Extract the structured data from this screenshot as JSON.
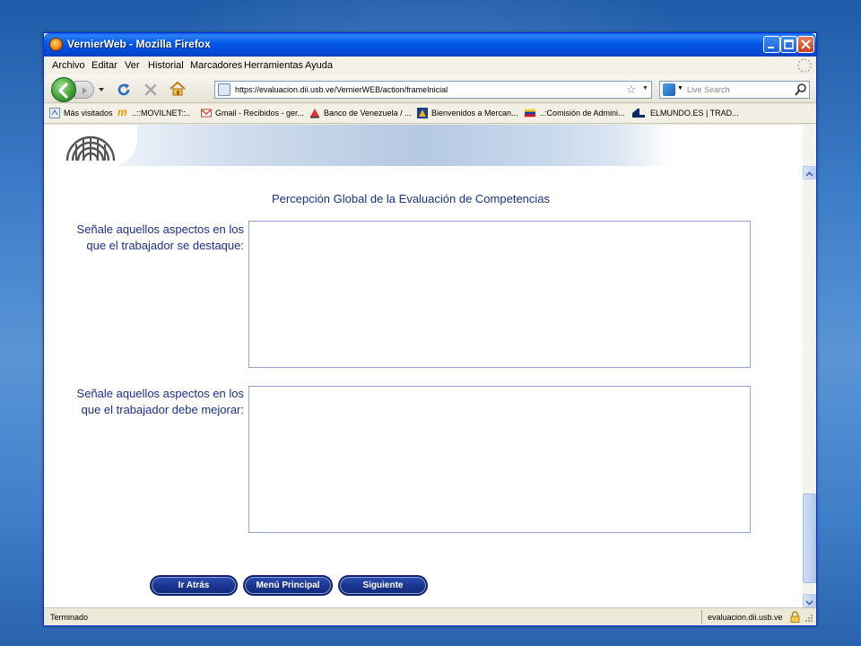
{
  "window": {
    "title": "VernierWeb - Mozilla Firefox"
  },
  "menu": {
    "items": [
      "Archivo",
      "Editar",
      "Ver",
      "Historial",
      "Marcadores",
      "Herramientas",
      "Ayuda"
    ]
  },
  "navigation": {
    "url": "https://evaluacion.dii.usb.ve/VernierWEB/action/frameInicial",
    "search_placeholder": "Live Search"
  },
  "bookmarks": [
    "Más visitados",
    "..::MOVILNET::..",
    "Gmail - Recibidos - ger...",
    "Banco de Venezuela / ...",
    "Bienvenidos a Mercan...",
    "..:Comisión de Admini...",
    "ELMUNDO.ES | TRAD..."
  ],
  "page": {
    "heading": "Percepción Global de la Evaluación de Competencias",
    "field1_line1": "Señale aquellos aspectos en los",
    "field1_line2": "que el trabajador se destaque:",
    "field2_line1": "Señale aquellos aspectos en los",
    "field2_line2": "que el trabajador debe mejorar:",
    "buttons": {
      "back": "Ir Atrás",
      "main_menu": "Menú Principal",
      "next": "Siguiente"
    }
  },
  "status": {
    "left": "Terminado",
    "right": "evaluacion.dii.usb.ve"
  },
  "colors": {
    "accent": "#1d2f8a",
    "button": "#1b3691",
    "titlebar": "#0058e6"
  }
}
